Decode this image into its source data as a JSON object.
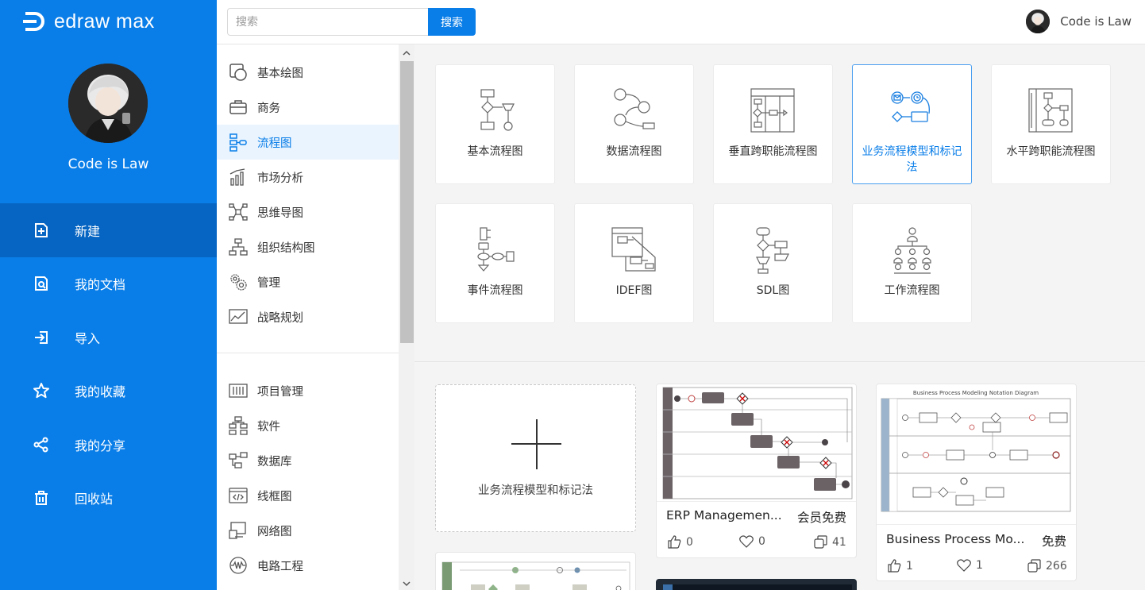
{
  "app": {
    "logo_text": "edraw max"
  },
  "user": {
    "name": "Code is Law"
  },
  "nav": [
    {
      "label": "新建",
      "icon": "new-file-icon",
      "active": true
    },
    {
      "label": "我的文档",
      "icon": "my-documents-icon",
      "active": false
    },
    {
      "label": "导入",
      "icon": "import-icon",
      "active": false
    },
    {
      "label": "我的收藏",
      "icon": "star-icon",
      "active": false
    },
    {
      "label": "我的分享",
      "icon": "share-icon",
      "active": false
    },
    {
      "label": "回收站",
      "icon": "trash-icon",
      "active": false
    }
  ],
  "search": {
    "placeholder": "搜索",
    "button": "搜索"
  },
  "categories": [
    {
      "label": "基本绘图",
      "icon": "basic-shapes-icon"
    },
    {
      "label": "商务",
      "icon": "briefcase-icon"
    },
    {
      "label": "流程图",
      "icon": "flowchart-icon",
      "active": true
    },
    {
      "label": "市场分析",
      "icon": "bar-chart-icon"
    },
    {
      "label": "思维导图",
      "icon": "mindmap-icon"
    },
    {
      "label": "组织结构图",
      "icon": "org-chart-icon"
    },
    {
      "label": "管理",
      "icon": "gears-icon"
    },
    {
      "label": "战略规划",
      "icon": "line-chart-icon"
    }
  ],
  "categories2": [
    {
      "label": "项目管理",
      "icon": "project-icon"
    },
    {
      "label": "软件",
      "icon": "software-icon"
    },
    {
      "label": "数据库",
      "icon": "database-icon"
    },
    {
      "label": "线框图",
      "icon": "wireframe-icon"
    },
    {
      "label": "网络图",
      "icon": "network-icon"
    },
    {
      "label": "电路工程",
      "icon": "circuit-icon"
    }
  ],
  "templates": [
    {
      "label": "基本流程图",
      "icon": "basic-flowchart-icon"
    },
    {
      "label": "数据流程图",
      "icon": "data-flow-icon"
    },
    {
      "label": "垂直跨职能流程图",
      "icon": "vertical-crossfunctional-icon"
    },
    {
      "label": "业务流程模型和标记法",
      "icon": "bpmn-icon",
      "selected": true
    },
    {
      "label": "水平跨职能流程图",
      "icon": "horizontal-crossfunctional-icon"
    },
    {
      "label": "事件流程图",
      "icon": "event-flow-icon"
    },
    {
      "label": "IDEF图",
      "icon": "idef-icon"
    },
    {
      "label": "SDL图",
      "icon": "sdl-icon"
    },
    {
      "label": "工作流程图",
      "icon": "workflow-icon"
    }
  ],
  "gallery": {
    "new_label": "业务流程模型和标记法",
    "cards": [
      {
        "name": "ERP Managemen...",
        "price": "会员免费",
        "likes": "0",
        "favorites": "0",
        "copies": "41"
      },
      {
        "name": "Business Process Mo...",
        "price": "免费",
        "likes": "1",
        "favorites": "1",
        "copies": "266",
        "thumb_title": "Business Process Modeling Notation Diagram"
      }
    ]
  },
  "colors": {
    "primary": "#0a7ee8",
    "sidebar_active": "#0665c2",
    "selected_border": "#4a9ff0"
  }
}
